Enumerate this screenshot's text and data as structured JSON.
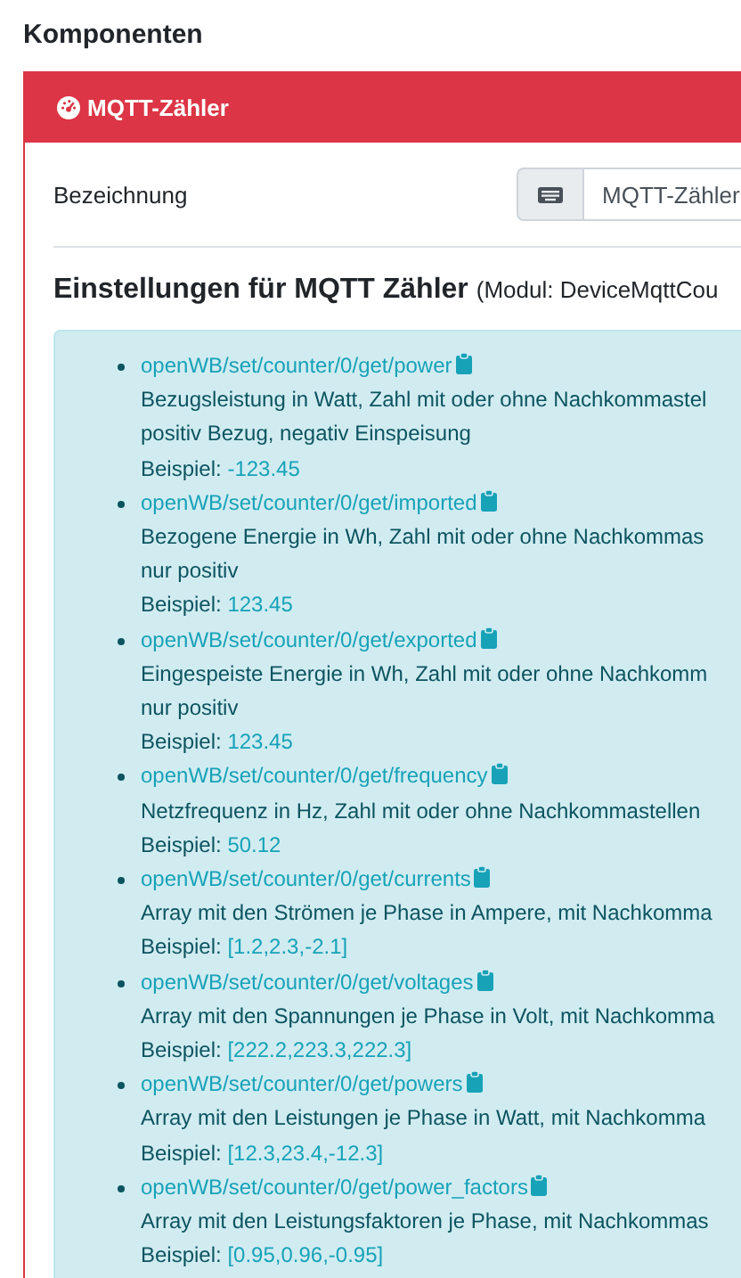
{
  "page_title": "Komponenten",
  "card": {
    "title": "MQTT-Zähler",
    "name_field": {
      "label": "Bezeichnung",
      "value": "MQTT-Zähler"
    },
    "settings_heading": "Einstellungen für MQTT Zähler",
    "settings_module": "(Modul: DeviceMqttCou",
    "topics": [
      {
        "topic": "openWB/set/counter/0/get/power",
        "description": [
          "Bezugsleistung in Watt, Zahl mit oder ohne Nachkommastel",
          "positiv Bezug, negativ Einspeisung"
        ],
        "example_label": "Beispiel:",
        "example": "-123.45"
      },
      {
        "topic": "openWB/set/counter/0/get/imported",
        "description": [
          "Bezogene Energie in Wh, Zahl mit oder ohne Nachkommas",
          "nur positiv"
        ],
        "example_label": "Beispiel:",
        "example": "123.45"
      },
      {
        "topic": "openWB/set/counter/0/get/exported",
        "description": [
          "Eingespeiste Energie in Wh, Zahl mit oder ohne Nachkomm",
          "nur positiv"
        ],
        "example_label": "Beispiel:",
        "example": "123.45"
      },
      {
        "topic": "openWB/set/counter/0/get/frequency",
        "description": [
          "Netzfrequenz in Hz, Zahl mit oder ohne Nachkommastellen"
        ],
        "example_label": "Beispiel:",
        "example": "50.12"
      },
      {
        "topic": "openWB/set/counter/0/get/currents",
        "description": [
          "Array mit den Strömen je Phase in Ampere, mit Nachkomma"
        ],
        "example_label": "Beispiel:",
        "example": "[1.2,2.3,-2.1]"
      },
      {
        "topic": "openWB/set/counter/0/get/voltages",
        "description": [
          "Array mit den Spannungen je Phase in Volt, mit Nachkomma"
        ],
        "example_label": "Beispiel:",
        "example": "[222.2,223.3,222.3]"
      },
      {
        "topic": "openWB/set/counter/0/get/powers",
        "description": [
          "Array mit den Leistungen je Phase in Watt, mit Nachkomma"
        ],
        "example_label": "Beispiel:",
        "example": "[12.3,23.4,-12.3]"
      },
      {
        "topic": "openWB/set/counter/0/get/power_factors",
        "description": [
          "Array mit den Leistungsfaktoren je Phase, mit Nachkommas"
        ],
        "example_label": "Beispiel:",
        "example": "[0.95,0.96,-0.95]"
      }
    ]
  }
}
